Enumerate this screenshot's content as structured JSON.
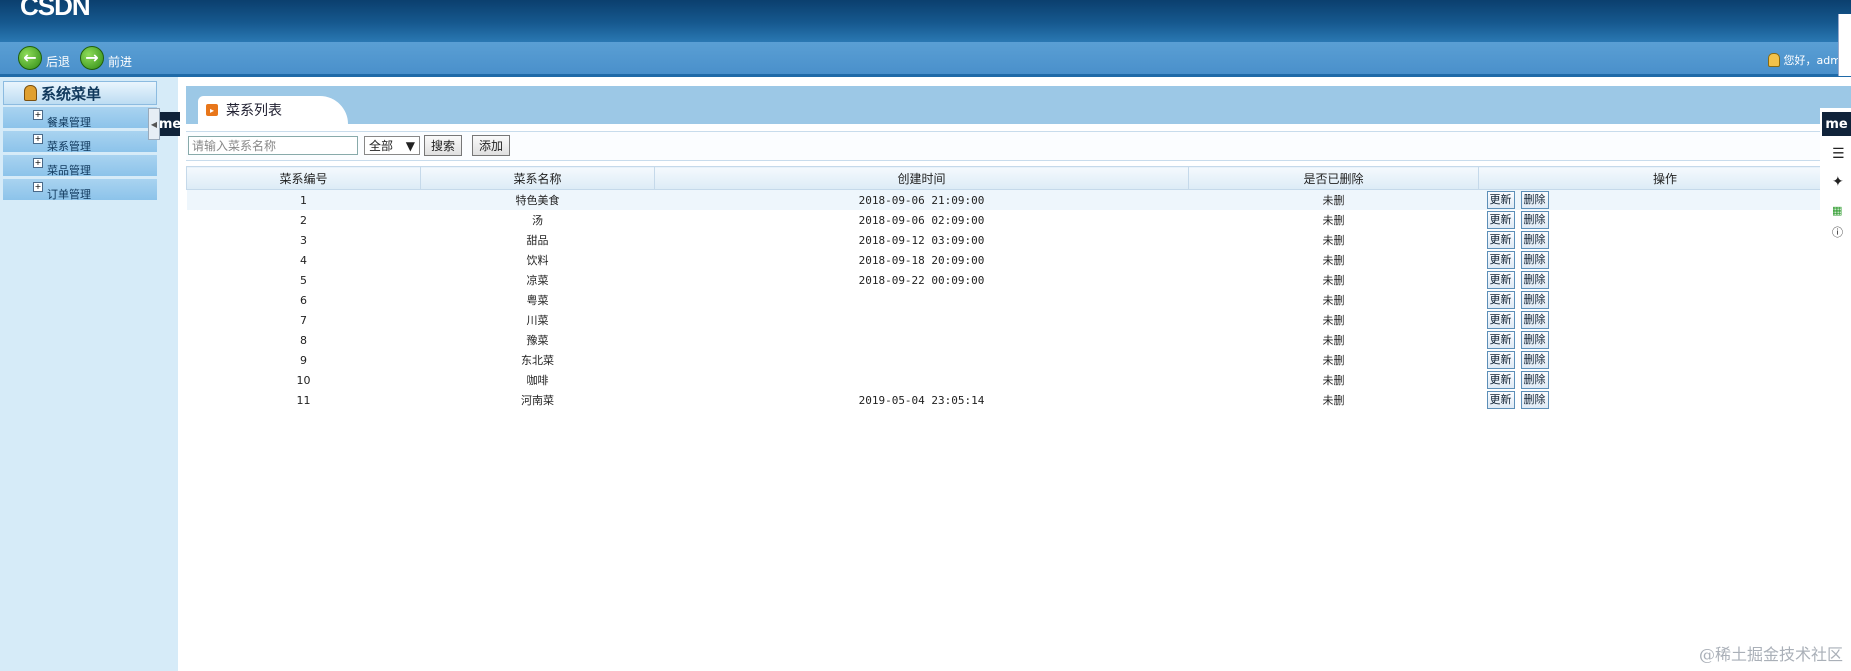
{
  "header": {
    "logo": "CSDN",
    "back_label": "后退",
    "forward_label": "前进",
    "greeting": "您好，adm"
  },
  "sidebar": {
    "title": "系统菜单",
    "items": [
      {
        "label": "餐桌管理"
      },
      {
        "label": "菜系管理"
      },
      {
        "label": "菜品管理"
      },
      {
        "label": "订单管理"
      }
    ],
    "badge": "me"
  },
  "main": {
    "tab_title": "菜系列表",
    "search": {
      "placeholder": "请输入菜系名称",
      "filter_value": "全部",
      "search_label": "搜索",
      "add_label": "添加"
    },
    "table": {
      "columns": [
        "菜系编号",
        "菜系名称",
        "创建时间",
        "是否已删除",
        "操作"
      ],
      "update_label": "更新",
      "delete_label": "删除",
      "rows": [
        {
          "id": "1",
          "name": "特色美食",
          "created": "2018-09-06 21:09:00",
          "deleted": "未删"
        },
        {
          "id": "2",
          "name": "汤",
          "created": "2018-09-06 02:09:00",
          "deleted": "未删"
        },
        {
          "id": "3",
          "name": "甜品",
          "created": "2018-09-12 03:09:00",
          "deleted": "未删"
        },
        {
          "id": "4",
          "name": "饮料",
          "created": "2018-09-18 20:09:00",
          "deleted": "未删"
        },
        {
          "id": "5",
          "name": "凉菜",
          "created": "2018-09-22 00:09:00",
          "deleted": "未删"
        },
        {
          "id": "6",
          "name": "粤菜",
          "created": "",
          "deleted": "未删"
        },
        {
          "id": "7",
          "name": "川菜",
          "created": "",
          "deleted": "未删"
        },
        {
          "id": "8",
          "name": "豫菜",
          "created": "",
          "deleted": "未删"
        },
        {
          "id": "9",
          "name": "东北菜",
          "created": "",
          "deleted": "未删"
        },
        {
          "id": "10",
          "name": "咖啡",
          "created": "",
          "deleted": "未删"
        },
        {
          "id": "11",
          "name": "河南菜",
          "created": "2019-05-04 23:05:14",
          "deleted": "未删"
        }
      ]
    }
  },
  "float_toolbar": {
    "badge": "me"
  },
  "watermark": "@稀土掘金技术社区",
  "colors": {
    "banner_dark": "#0b3f6e",
    "nav_blue": "#4a90cb",
    "sidebar_bg": "#d6ebf8",
    "tab_strip": "#9cc8e6"
  }
}
